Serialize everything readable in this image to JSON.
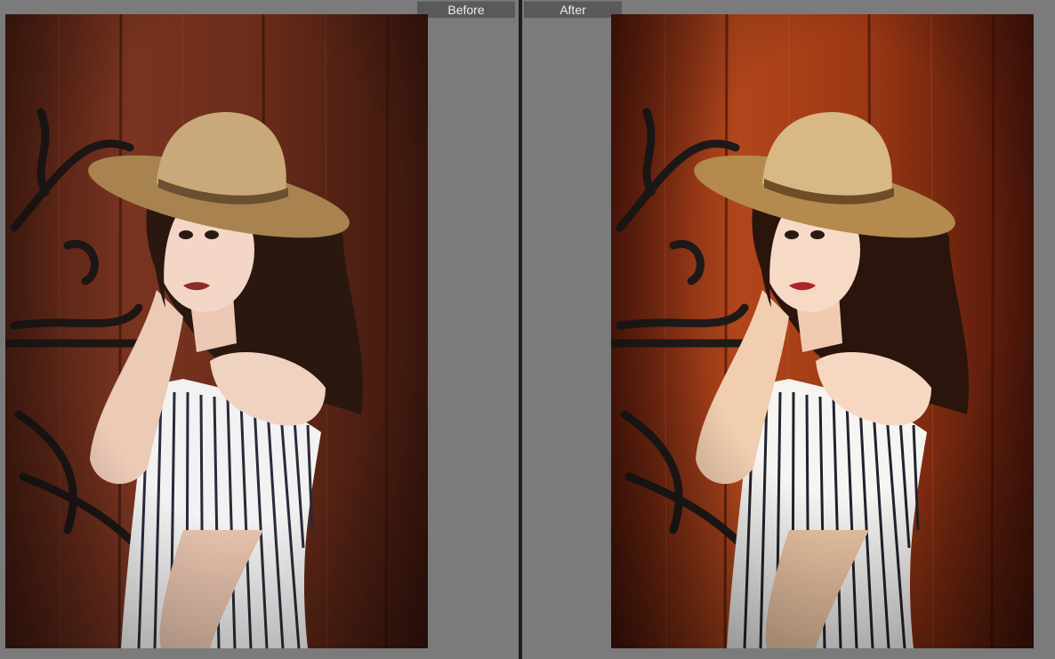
{
  "compare_view": {
    "before_label": "Before",
    "after_label": "After"
  },
  "photos": {
    "before": {
      "tone": "muted",
      "wood_color": "#6e2f1c",
      "wood_dark": "#3d1810"
    },
    "after": {
      "tone": "warm",
      "wood_color": "#9b3414",
      "wood_dark": "#4a140a"
    }
  }
}
